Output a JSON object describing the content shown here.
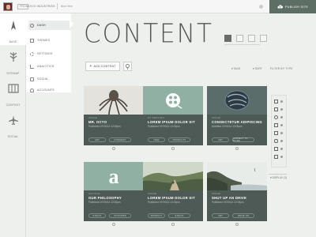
{
  "topbar": {
    "pill": "PRO",
    "org": "MOVIX INDUSTRIES",
    "crumb": "Blue Hive",
    "publish_label": "PUBLISH SITE"
  },
  "rail": [
    {
      "label": "BASE",
      "icon": "compass-icon",
      "active": true
    },
    {
      "label": "SITEMAP",
      "icon": "tree-icon",
      "active": false
    },
    {
      "label": "CONTENT",
      "icon": "columns-icon",
      "active": false
    },
    {
      "label": "SOCIAL",
      "icon": "plane-icon",
      "active": false
    }
  ],
  "nav": [
    {
      "label": "DASH",
      "icon": "dash-icon",
      "active": true
    },
    {
      "label": "THEMES",
      "icon": "themes-icon",
      "active": false
    },
    {
      "label": "SETTINGS",
      "icon": "settings-icon",
      "active": false
    },
    {
      "label": "ANALYTICS",
      "icon": "analytics-icon",
      "active": false
    },
    {
      "label": "SOCIAL",
      "icon": "social-icon",
      "active": false
    },
    {
      "label": "ACCOUNTS",
      "icon": "accounts-icon",
      "active": false
    }
  ],
  "main": {
    "title": "CONTENT",
    "add_label": "ADD CONTENT",
    "tags_label": "TAGS",
    "sort_label": "SORT",
    "filter_label": "FILTER BY TYPE",
    "display_label": "DISPLAY (3)"
  },
  "cards": [
    {
      "type": "IMAGE",
      "title": "MR. OCTO",
      "date": "Published 07/06/14 12:05pm",
      "tag1": "ART",
      "tag2": "INTEREST",
      "img": "octo"
    },
    {
      "type": "ST SESSION",
      "title": "LOREM IPSUM DOLOR SIT",
      "date": "Published 07/06/14 12:05pm",
      "tag1": "NEW",
      "tag2": "PRODUCTS",
      "img": "video"
    },
    {
      "type": "IMAGE",
      "title": "CONSECTETUR ADIPISCING",
      "date": "Modified 07/06/14 12:05pm",
      "tag1": "ART",
      "tag2": "SUBJECT TO MORE",
      "img": "shell"
    },
    {
      "type": "ARTICLE",
      "title": "OUR PHILOSOPHY",
      "date": "Published 07/06/14 12:05pm",
      "tag1": "ETHICS",
      "tag2": "OCTOPIDS",
      "img": "letter"
    },
    {
      "type": "IMAGE",
      "title": "LOREM IPSUM DOLOR SIT",
      "date": "Published 07/06/14 12:05pm",
      "tag1": "PRODUCT",
      "tag2": "ETHICS",
      "img": "path"
    },
    {
      "type": "IMAGE",
      "title": "SHUT UP AN DRIVE",
      "date": "Published 07/06/14 12:05pm",
      "tag1": "ART",
      "tag2": "DRIVE ON",
      "img": "coast"
    }
  ],
  "colors": {
    "accent": "#5d6e65",
    "card": "#4e5a55",
    "teal": "#8fb0a2"
  }
}
